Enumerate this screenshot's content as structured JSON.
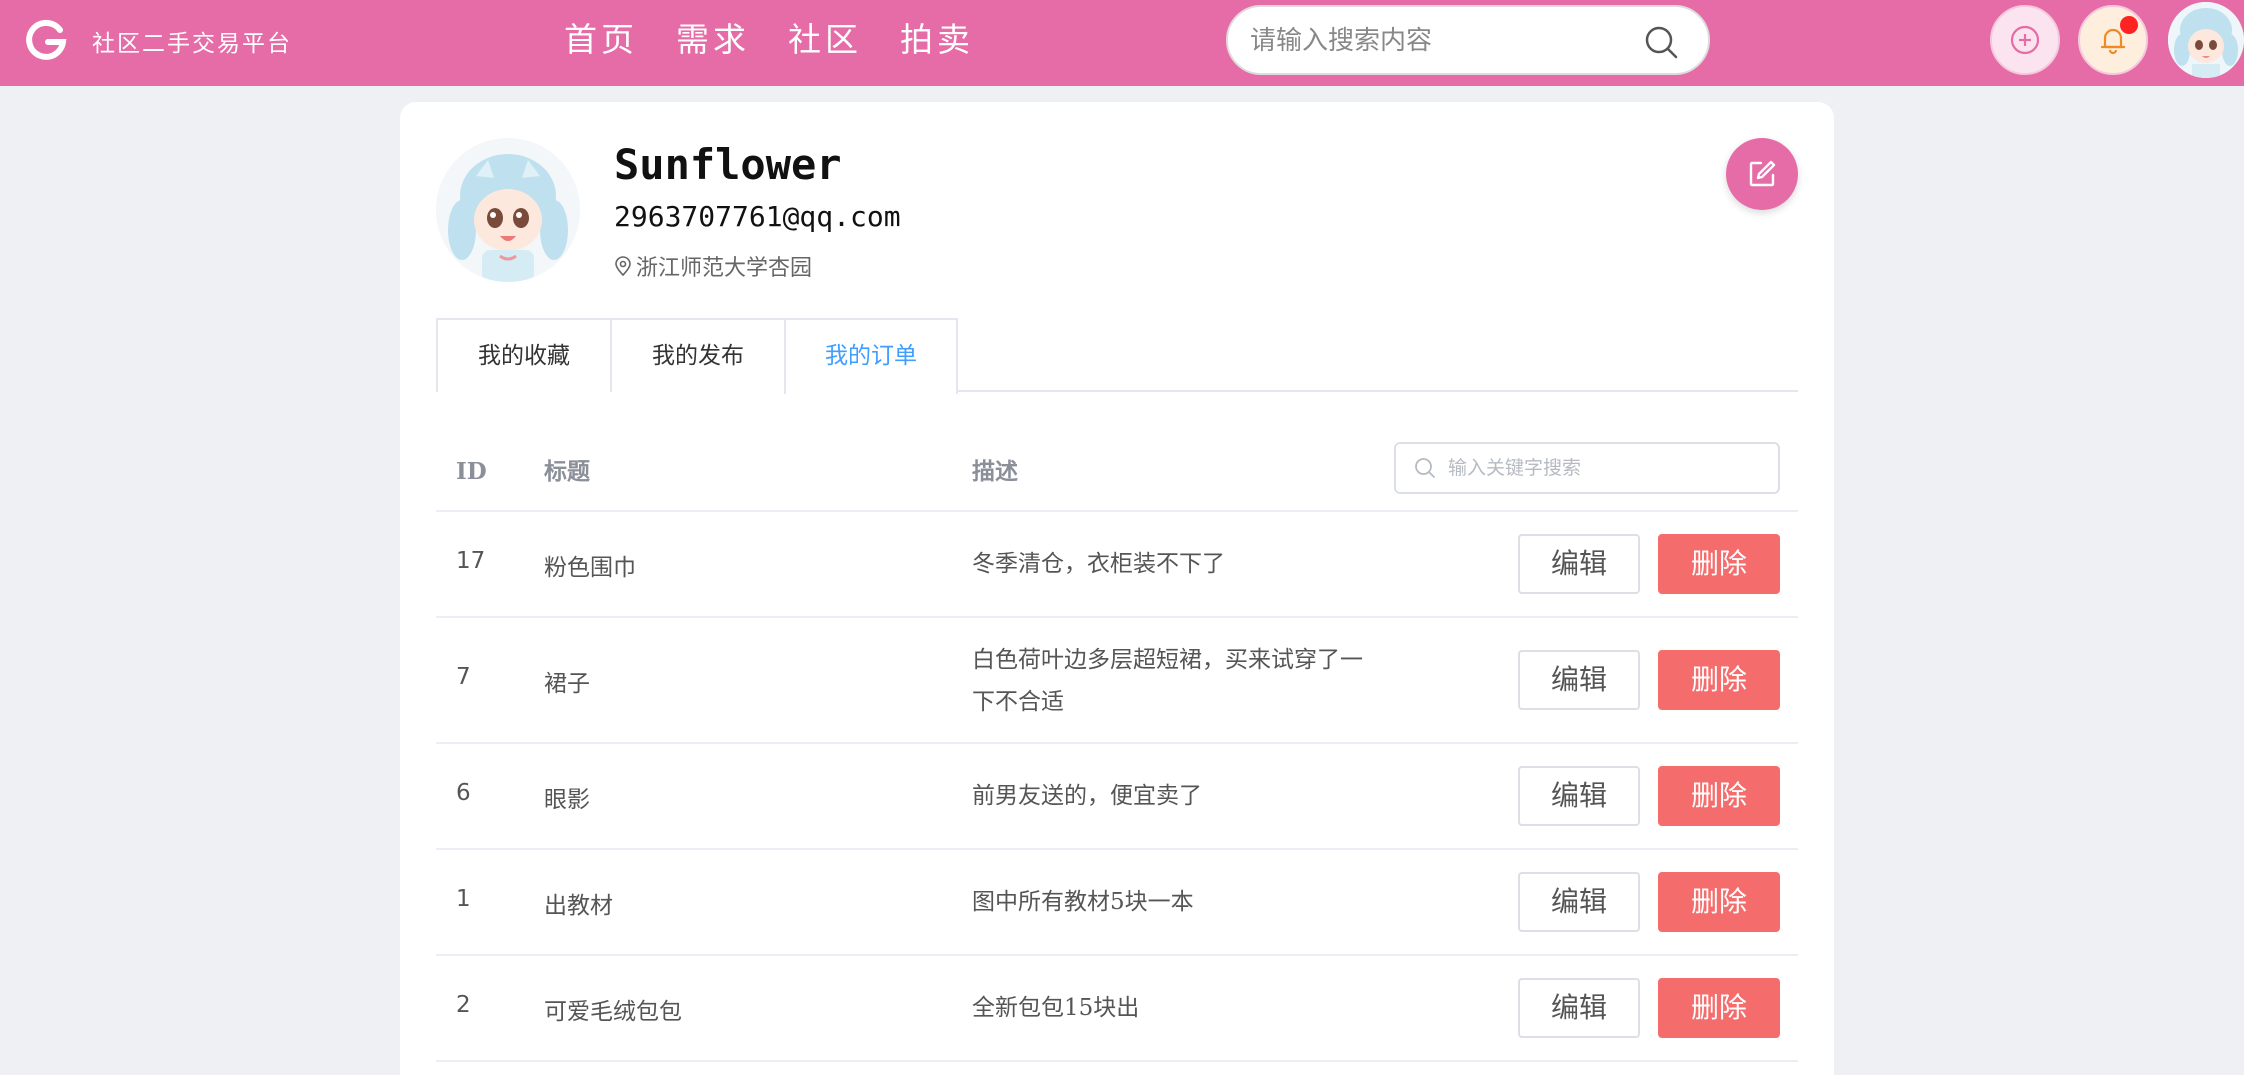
{
  "header": {
    "brand": "社区二手交易平台",
    "nav": [
      "首页",
      "需求",
      "社区",
      "拍卖"
    ],
    "search_placeholder": "请输入搜索内容",
    "has_notification": true
  },
  "profile": {
    "username": "Sunflower",
    "email": "2963707761@qq.com",
    "location": "浙江师范大学杏园"
  },
  "tabs": [
    {
      "label": "我的收藏",
      "active": false
    },
    {
      "label": "我的发布",
      "active": false
    },
    {
      "label": "我的订单",
      "active": true
    }
  ],
  "table": {
    "headers": {
      "id": "ID",
      "title": "标题",
      "desc": "描述"
    },
    "filter_placeholder": "输入关键字搜索",
    "edit_label": "编辑",
    "delete_label": "删除",
    "rows": [
      {
        "id": "17",
        "title": "粉色围巾",
        "desc": "冬季清仓，衣柜装不下了"
      },
      {
        "id": "7",
        "title": "裙子",
        "desc": "白色荷叶边多层超短裙，买来试穿了一下不合适"
      },
      {
        "id": "6",
        "title": "眼影",
        "desc": "前男友送的，便宜卖了"
      },
      {
        "id": "1",
        "title": "出教材",
        "desc": "图中所有教材5块一本"
      },
      {
        "id": "2",
        "title": "可爱毛绒包包",
        "desc": "全新包包15块出"
      }
    ]
  },
  "colors": {
    "brand": "#e66ca8",
    "active_tab": "#409eff",
    "danger": "#f56c6c"
  }
}
